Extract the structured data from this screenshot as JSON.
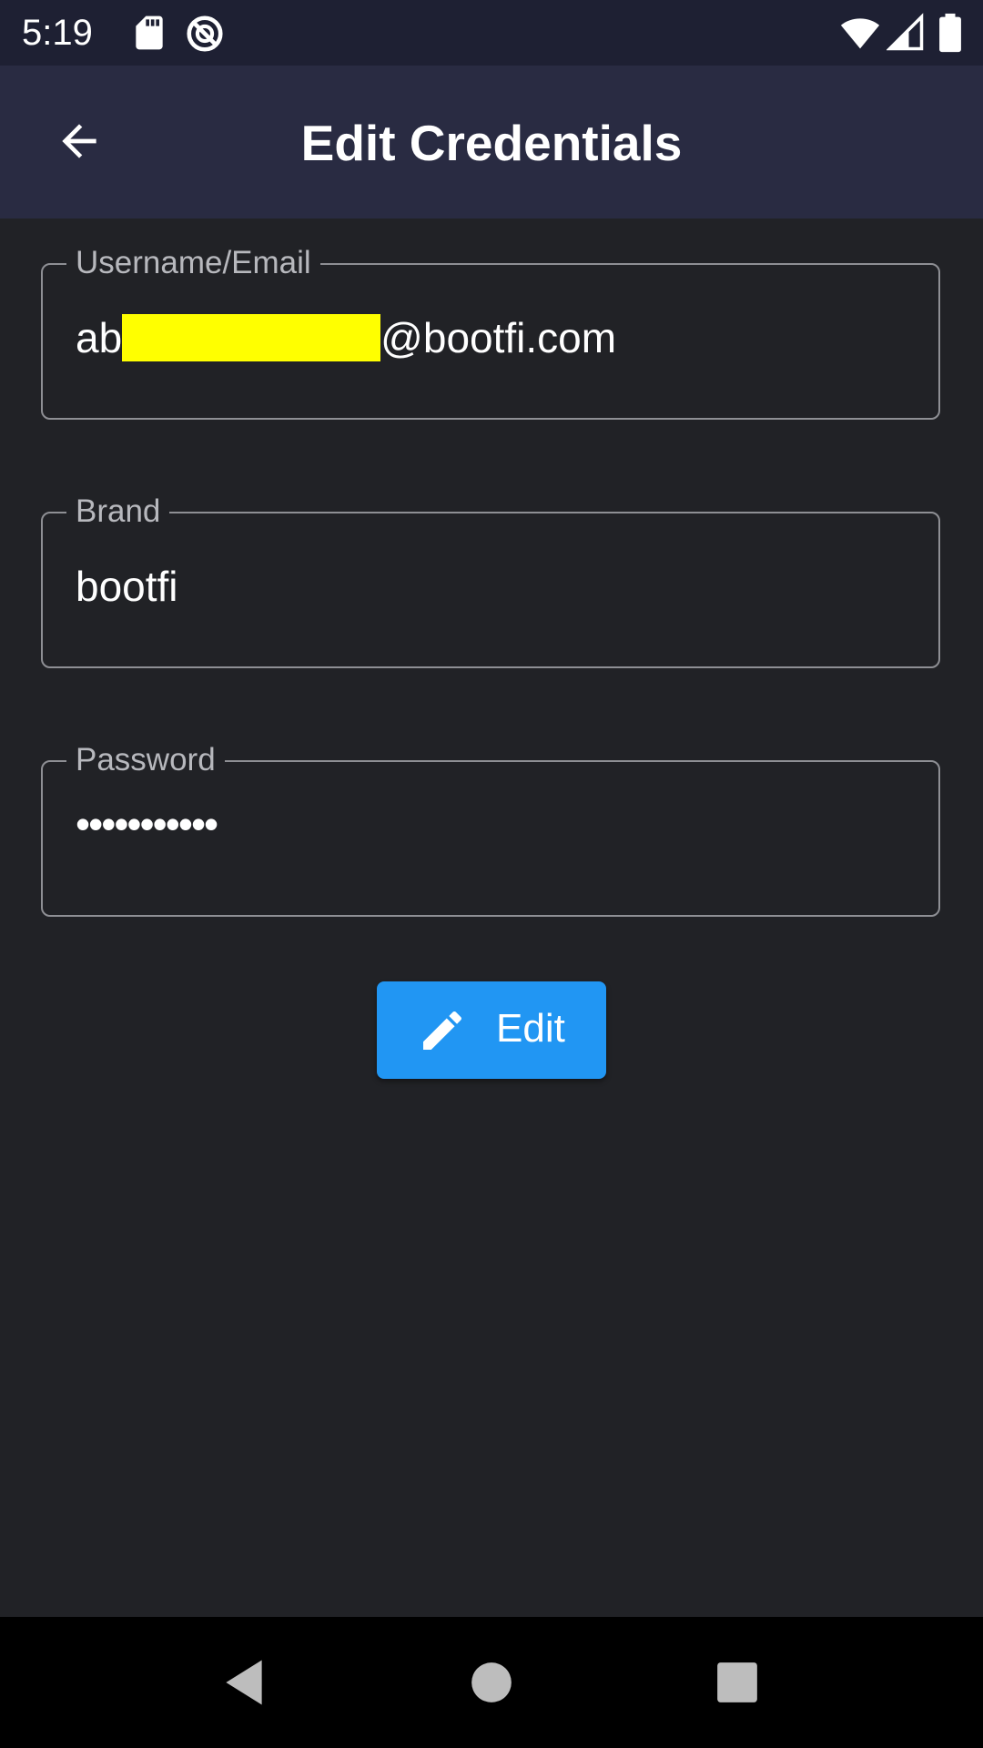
{
  "status_bar": {
    "time": "5:19",
    "icons": [
      "sd-card-icon",
      "do-not-disturb-icon",
      "wifi-icon",
      "cell-signal-icon",
      "battery-icon"
    ]
  },
  "app_bar": {
    "title": "Edit Credentials",
    "back_icon": "arrow-back-icon"
  },
  "form": {
    "username": {
      "label": "Username/Email",
      "value_prefix": "ab",
      "value_suffix": "@bootfi.com",
      "redaction_color": "#ffff00"
    },
    "brand": {
      "label": "Brand",
      "value": "bootfi"
    },
    "password": {
      "label": "Password",
      "value": "•••••••••••"
    }
  },
  "edit_button": {
    "label": "Edit",
    "icon": "pencil-icon",
    "color": "#2196f3"
  },
  "nav_bar": {
    "icons": [
      "nav-back-icon",
      "nav-home-icon",
      "nav-recents-icon"
    ]
  },
  "colors": {
    "background": "#212226",
    "status_bar": "#1e2033",
    "app_bar": "#292b42",
    "field_border": "#8e8f94",
    "label": "#b7b8bd",
    "accent": "#2196f3"
  }
}
